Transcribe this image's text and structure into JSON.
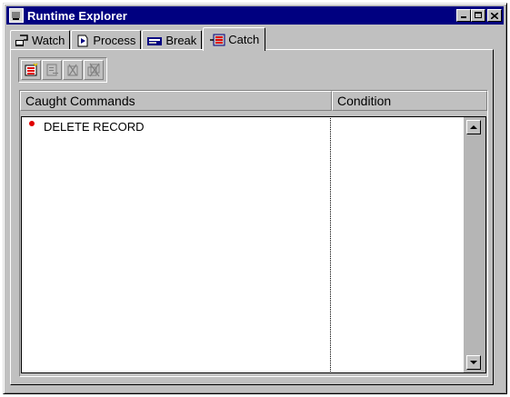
{
  "window": {
    "title": "Runtime Explorer",
    "icon": "runtime-explorer-icon",
    "title_bar_color": "#000080"
  },
  "tabs": [
    {
      "label": "Watch",
      "icon": "watch-icon",
      "active": false
    },
    {
      "label": "Process",
      "icon": "process-icon",
      "active": false
    },
    {
      "label": "Break",
      "icon": "break-icon",
      "active": false
    },
    {
      "label": "Catch",
      "icon": "catch-icon",
      "active": true
    }
  ],
  "toolbar": {
    "buttons": [
      {
        "icon": "add-catch-icon"
      },
      {
        "icon": "edit-catch-icon"
      },
      {
        "icon": "delete-catch-icon"
      },
      {
        "icon": "delete-all-catch-icon"
      }
    ]
  },
  "table": {
    "columns": [
      "Caught Commands",
      "Condition"
    ],
    "rows": [
      {
        "command": "DELETE RECORD",
        "condition": "",
        "marker_color": "#e00000"
      }
    ]
  }
}
